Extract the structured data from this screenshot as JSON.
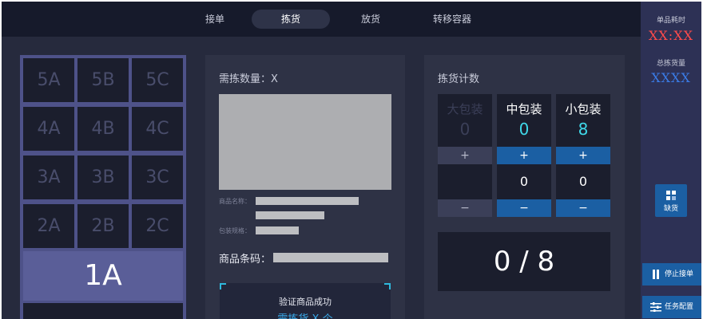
{
  "nav": {
    "tabs": [
      {
        "label": "接单",
        "active": false
      },
      {
        "label": "拣货",
        "active": true
      },
      {
        "label": "放货",
        "active": false
      },
      {
        "label": "转移容器",
        "active": false
      }
    ]
  },
  "sidebar": {
    "unit_time_label": "单品耗时",
    "unit_time_value": "XX:XX",
    "total_picked_label": "总拣货量",
    "total_picked_value": "XXXX",
    "shortage_label": "缺货",
    "pause_label": "停止接单",
    "task_config_label": "任务配置"
  },
  "bins": {
    "rows": [
      [
        "5A",
        "5B",
        "5C"
      ],
      [
        "4A",
        "4B",
        "4C"
      ],
      [
        "3A",
        "3B",
        "3C"
      ],
      [
        "2A",
        "2B",
        "2C"
      ]
    ],
    "active": "1A"
  },
  "pick": {
    "qty_label": "需拣数量：X",
    "product_name_label": "商品名称：",
    "package_spec_label": "包装规格：",
    "barcode_label": "商品条码：",
    "verify_ok": "验证商品成功",
    "verify_sub": "需拣货 X 个"
  },
  "counter": {
    "title": "拣货计数",
    "columns": [
      {
        "name": "大包装",
        "count": "0",
        "plus": "+",
        "minus": "−",
        "value": "",
        "enabled": false
      },
      {
        "name": "中包装",
        "count": "0",
        "plus": "+",
        "minus": "−",
        "value": "0",
        "enabled": true
      },
      {
        "name": "小包装",
        "count": "8",
        "plus": "+",
        "minus": "−",
        "value": "0",
        "enabled": true
      }
    ],
    "progress": "0 / 8"
  },
  "colors": {
    "accent_blue": "#1b5fa3",
    "alert_red": "#ff4b4b",
    "count_cyan": "#3fd9ea",
    "bin_active": "#5a5e98"
  }
}
